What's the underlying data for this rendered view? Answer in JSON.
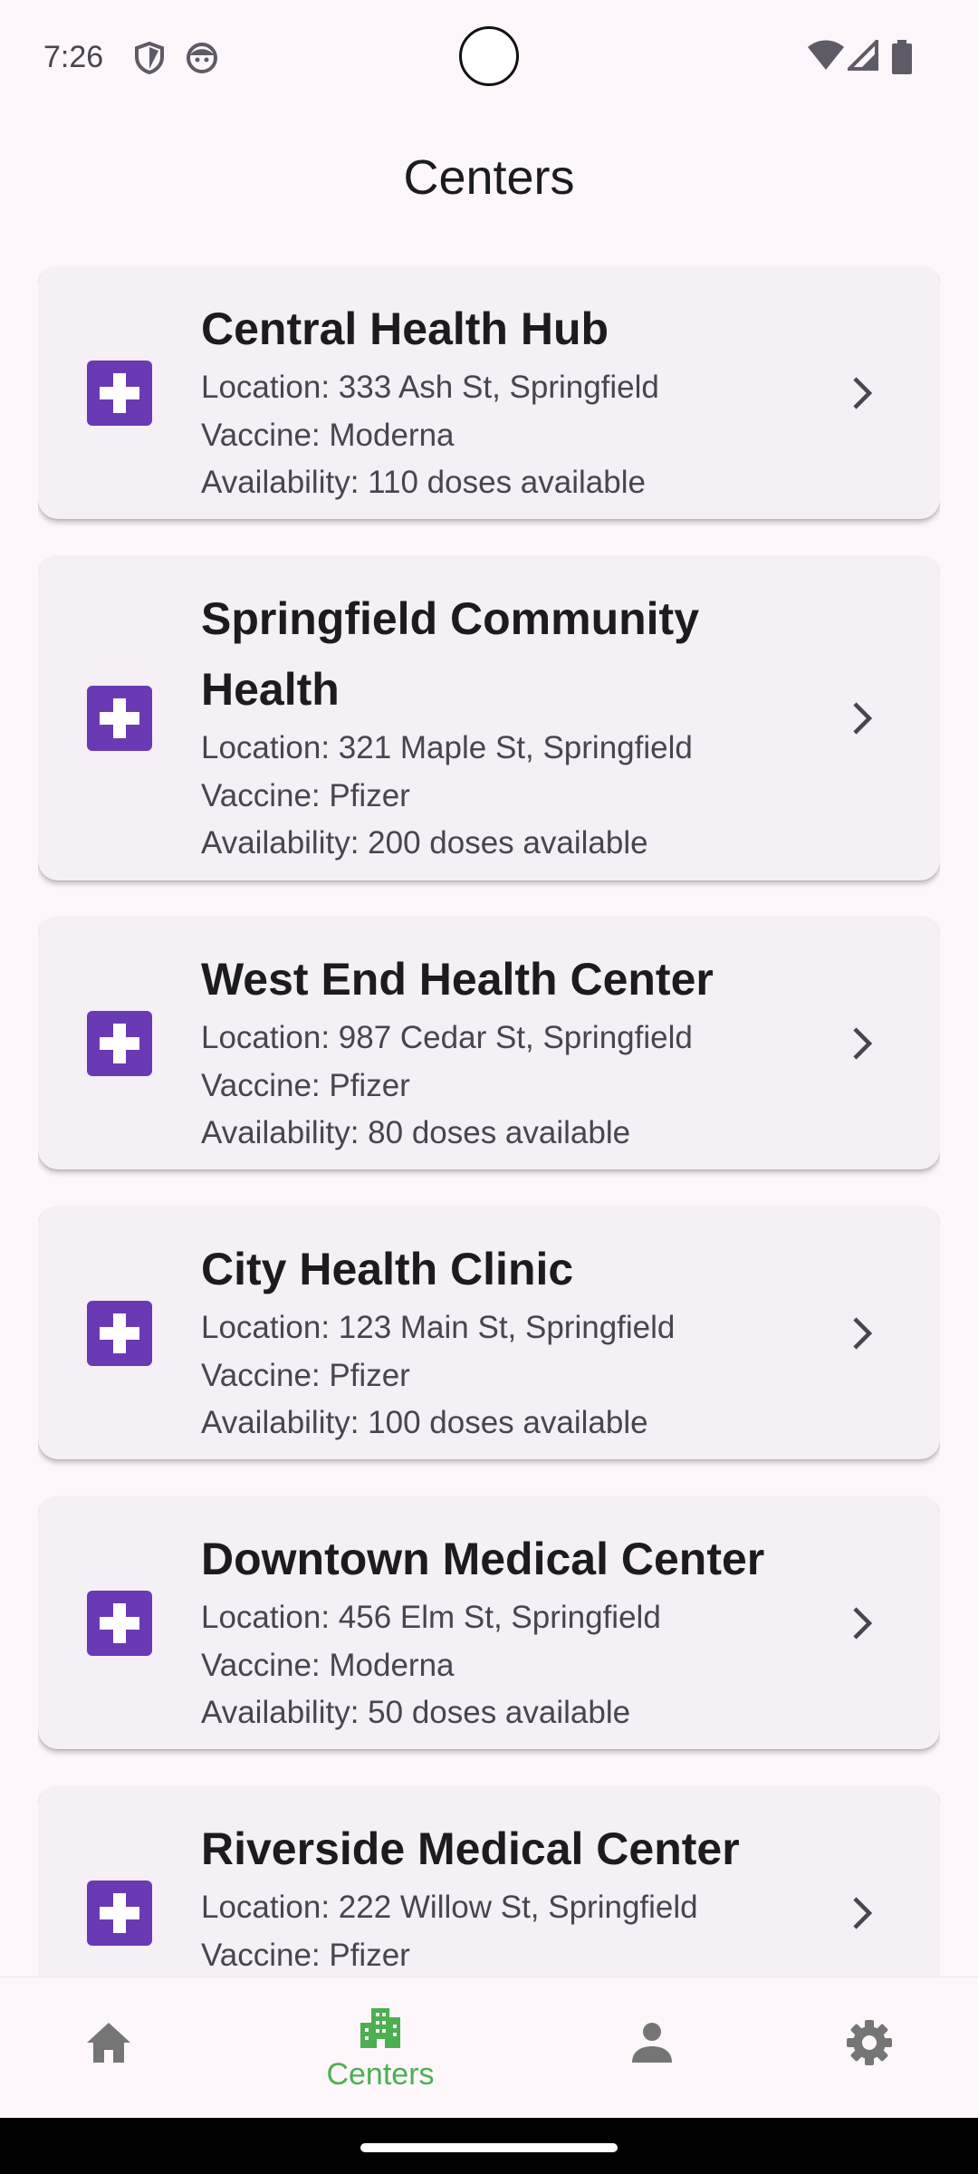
{
  "status_bar": {
    "time": "7:26",
    "icons": [
      "shield-icon",
      "face-icon",
      "wifi-icon",
      "cell-signal-icon",
      "battery-icon"
    ]
  },
  "header": {
    "title": "Centers"
  },
  "centers": [
    {
      "name": "Central Health Hub",
      "location": "Location: 333 Ash St, Springfield",
      "vaccine": "Vaccine: Moderna",
      "availability": "Availability: 110 doses available"
    },
    {
      "name": "Springfield Community Health",
      "location": "Location: 321 Maple St, Springfield",
      "vaccine": "Vaccine: Pfizer",
      "availability": "Availability: 200 doses available"
    },
    {
      "name": "West End Health Center",
      "location": "Location: 987 Cedar St, Springfield",
      "vaccine": "Vaccine: Pfizer",
      "availability": "Availability: 80 doses available"
    },
    {
      "name": "City Health Clinic",
      "location": "Location: 123 Main St, Springfield",
      "vaccine": "Vaccine: Pfizer",
      "availability": "Availability: 100 doses available"
    },
    {
      "name": "Downtown Medical Center",
      "location": "Location: 456 Elm St, Springfield",
      "vaccine": "Vaccine: Moderna",
      "availability": "Availability: 50 doses available"
    },
    {
      "name": "Riverside Medical Center",
      "location": "Location: 222 Willow St, Springfield",
      "vaccine": "Vaccine: Pfizer",
      "availability": ""
    }
  ],
  "bottom_nav": {
    "items": [
      {
        "icon": "home-icon",
        "label": ""
      },
      {
        "icon": "building-icon",
        "label": "Centers",
        "selected": true
      },
      {
        "icon": "person-icon",
        "label": ""
      },
      {
        "icon": "gear-icon",
        "label": ""
      }
    ]
  },
  "colors": {
    "accent": "#6a3ab4",
    "nav_selected": "#4caf50",
    "nav_unselected": "#757575",
    "card_bg": "#f5eff6",
    "page_bg": "#fdf7fc"
  }
}
